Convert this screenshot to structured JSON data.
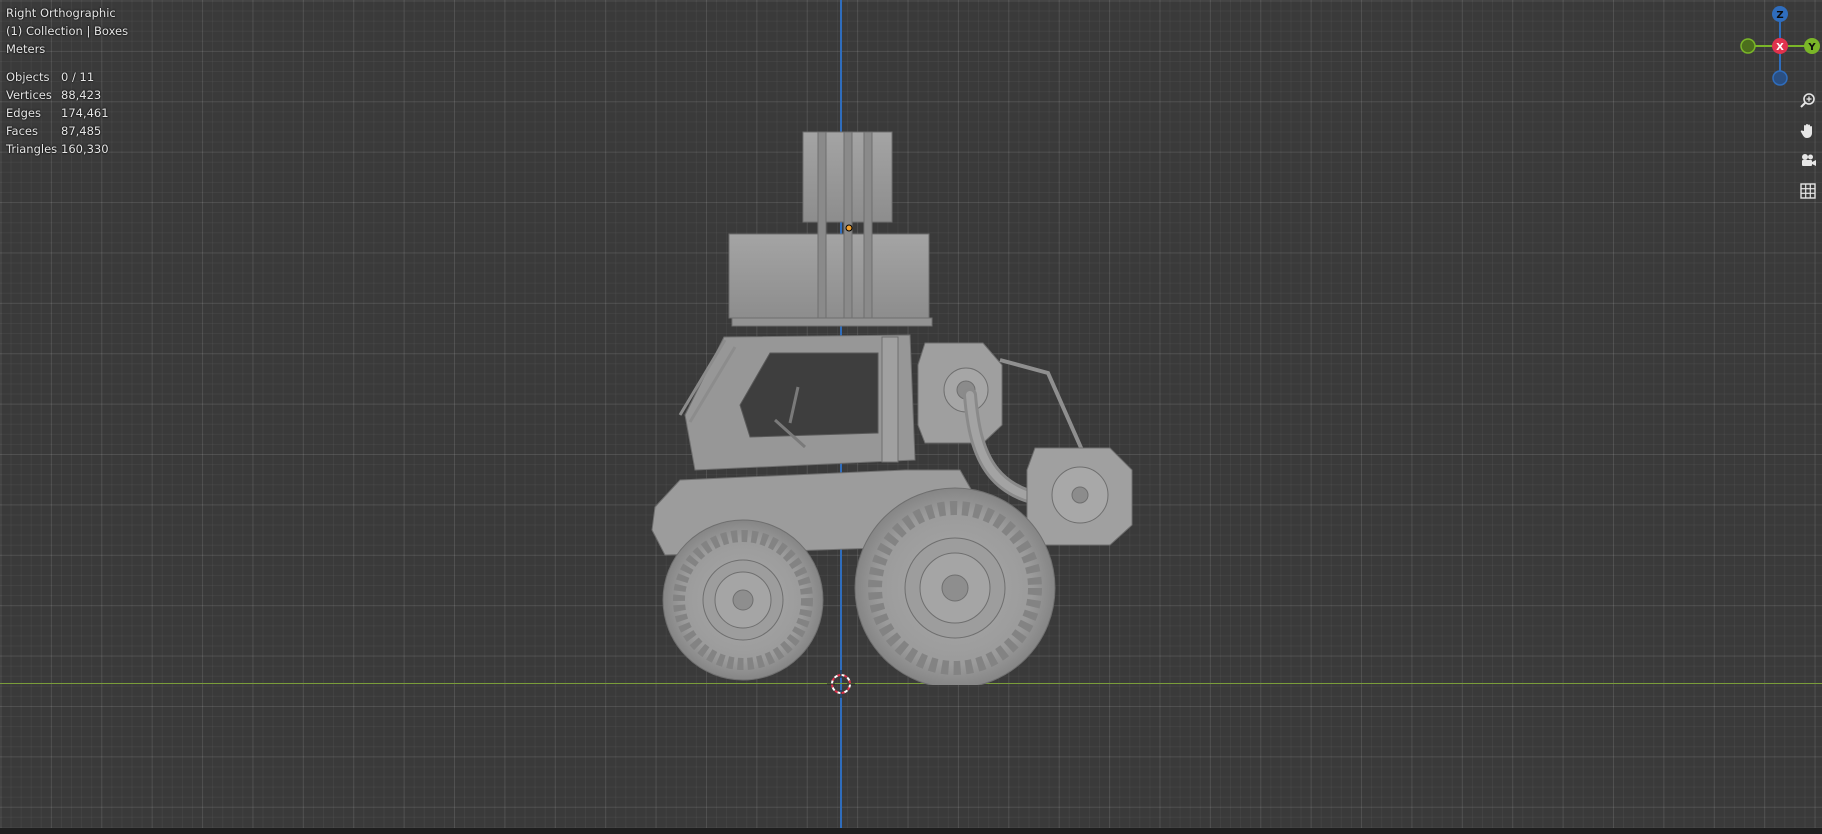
{
  "viewport": {
    "view_name": "Right Orthographic",
    "collection": "(1) Collection | Boxes",
    "units": "Meters"
  },
  "stats": [
    {
      "label": "Objects",
      "value": "0 / 11"
    },
    {
      "label": "Vertices",
      "value": "88,423"
    },
    {
      "label": "Edges",
      "value": "174,461"
    },
    {
      "label": "Faces",
      "value": "87,485"
    },
    {
      "label": "Triangles",
      "value": "160,330"
    }
  ],
  "gizmo": {
    "z_label": "Z",
    "x_label": "X",
    "y_label": "Y",
    "colors": {
      "z": "#2f6dbd",
      "x": "#e0324d",
      "y": "#7ab628"
    }
  },
  "nav_buttons": [
    {
      "name": "zoom-icon"
    },
    {
      "name": "hand-pan-icon"
    },
    {
      "name": "camera-icon"
    },
    {
      "name": "grid-icon"
    }
  ],
  "colors": {
    "background": "#3a3a3a",
    "z_axis": "#2f6dbd",
    "y_axis": "#7a9d3a",
    "model": "#9a9a9a"
  }
}
